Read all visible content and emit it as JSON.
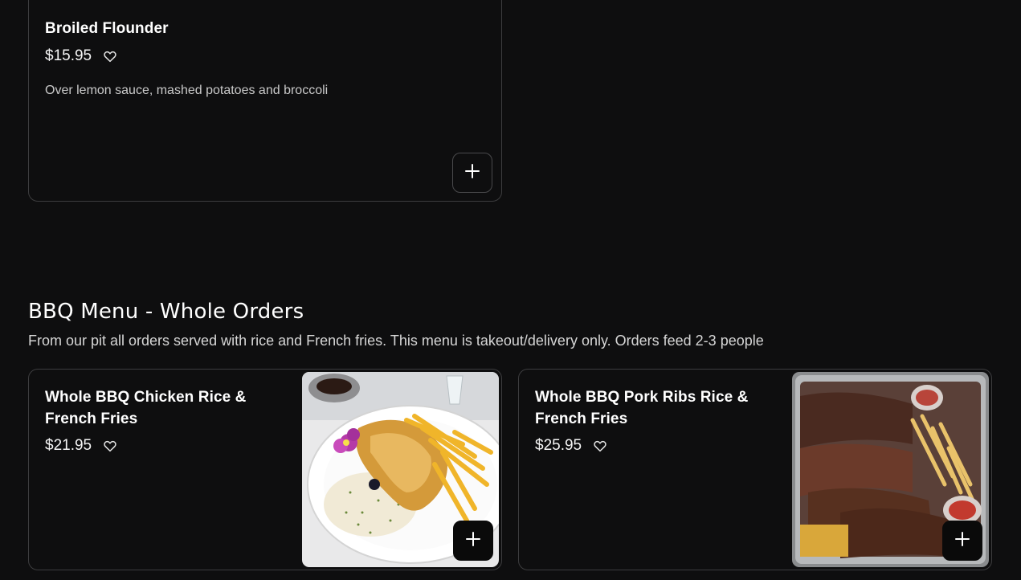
{
  "previous_item": {
    "title": "Broiled Flounder",
    "price": "$15.95",
    "description": "Over lemon sauce, mashed potatoes and broccoli",
    "icons": {
      "favorite": "heart-outline-icon",
      "add": "plus-icon"
    }
  },
  "section": {
    "heading": "BBQ Menu - Whole Orders",
    "subheading": "From our pit all orders served with rice and French fries. This menu is takeout/delivery only. Orders feed 2-3 people",
    "items": [
      {
        "title": "Whole BBQ Chicken Rice & French Fries",
        "price": "$21.95",
        "image": "bbq-chicken-rice-fries-photo"
      },
      {
        "title": "Whole BBQ Pork Ribs Rice & French Fries",
        "price": "$25.95",
        "image": "bbq-pork-ribs-rice-fries-photo"
      }
    ]
  },
  "colors": {
    "background": "#0e0e0f",
    "card_border": "#3d3d3f",
    "text": "#ffffff",
    "muted_text": "#c9c9c9"
  }
}
